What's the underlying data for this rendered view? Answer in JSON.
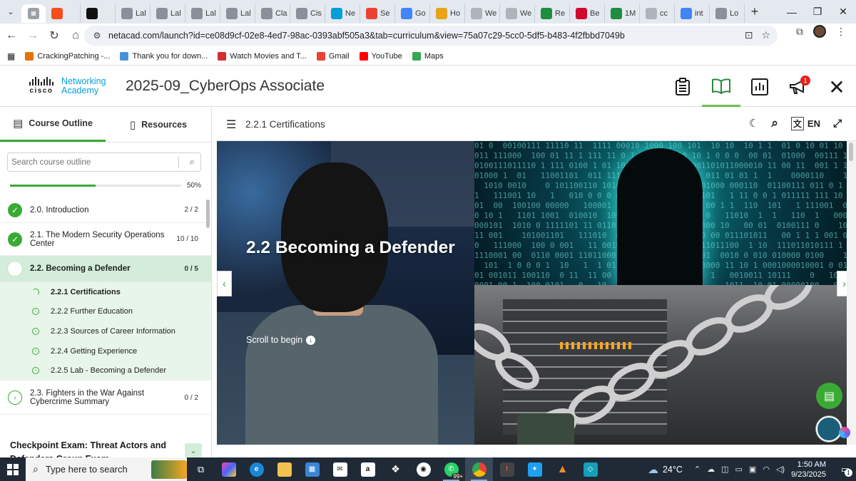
{
  "browser": {
    "tabs": [
      {
        "label": "",
        "icon": "figma-icon",
        "color": "#f24e1e"
      },
      {
        "label": "",
        "icon": "medium-icon",
        "color": "#111111"
      },
      {
        "label": "Lal",
        "icon": "lab-icon",
        "color": "#8a8f99"
      },
      {
        "label": "Lal",
        "icon": "lab-icon",
        "color": "#8a8f99"
      },
      {
        "label": "Lal",
        "icon": "lab-icon",
        "color": "#8a8f99"
      },
      {
        "label": "Lal",
        "icon": "lab-icon",
        "color": "#8a8f99"
      },
      {
        "label": "Cla",
        "icon": "lab-icon",
        "color": "#8a8f99"
      },
      {
        "label": "Cis",
        "icon": "lab-icon",
        "color": "#8a8f99"
      },
      {
        "label": "Ne",
        "icon": "netacad-icon",
        "color": "#049fd9"
      },
      {
        "label": "Se",
        "icon": "gmail-icon",
        "color": "#ea4335"
      },
      {
        "label": "Go",
        "icon": "gemini-icon",
        "color": "#4285f4"
      },
      {
        "label": "Ho",
        "icon": "home-icon",
        "color": "#e8a317"
      },
      {
        "label": "We",
        "icon": "web-icon",
        "color": "#b0b4ba"
      },
      {
        "label": "We",
        "icon": "web-icon",
        "color": "#b0b4ba"
      },
      {
        "label": "Re",
        "icon": "reg-icon",
        "color": "#1e8e3e"
      },
      {
        "label": "Be",
        "icon": "huawei-icon",
        "color": "#cf0a2c"
      },
      {
        "label": "1M",
        "icon": "reg-icon",
        "color": "#1e8e3e"
      },
      {
        "label": "cc",
        "icon": "web-icon",
        "color": "#b0b4ba"
      },
      {
        "label": "int",
        "icon": "google-icon",
        "color": "#4285f4"
      },
      {
        "label": "Lo",
        "icon": "lab-icon",
        "color": "#8a8f99"
      }
    ],
    "url": "netacad.com/launch?id=ce08d9cf-02e8-4ed7-98ac-0393abf505a3&tab=curriculum&view=75a07c29-5cc0-5df5-b483-4f2fbbd7049b",
    "bookmarks": [
      {
        "label": "CrackingPatching -...",
        "icon": "crackingpatching-icon",
        "color": "#e37400"
      },
      {
        "label": "Thank you for down...",
        "icon": "bookmark-fav-icon",
        "color": "#4a90d9"
      },
      {
        "label": "Watch Movies and T...",
        "icon": "movies-icon",
        "color": "#d32f2f"
      },
      {
        "label": "Gmail",
        "icon": "gmail-icon",
        "color": "#ea4335"
      },
      {
        "label": "YouTube",
        "icon": "youtube-icon",
        "color": "#ff0000"
      },
      {
        "label": "Maps",
        "icon": "maps-icon",
        "color": "#34a853"
      }
    ]
  },
  "header": {
    "logo_brand": "cisco",
    "logo_line1": "Networking",
    "logo_line2": "Academy",
    "course_title": "2025-09_CyberOps Associate",
    "notification_count": "1"
  },
  "sidebar": {
    "tab_outline": "Course Outline",
    "tab_resources": "Resources",
    "search_placeholder": "Search course outline",
    "progress_percent": "50%",
    "progress_value": 0.5,
    "modules": [
      {
        "label": "2.0. Introduction",
        "count": "2 / 2",
        "status": "complete"
      },
      {
        "label": "2.1. The Modern Security Operations Center",
        "count": "10 / 10",
        "status": "complete"
      },
      {
        "label": "2.2. Becoming a Defender",
        "count": "0 / 5",
        "status": "in-progress"
      }
    ],
    "subitems": [
      {
        "label": "2.2.1 Certifications",
        "current": true
      },
      {
        "label": "2.2.2 Further Education",
        "current": false
      },
      {
        "label": "2.2.3 Sources of Career Information",
        "current": false
      },
      {
        "label": "2.2.4 Getting Experience",
        "current": false
      },
      {
        "label": "2.2.5 Lab - Becoming a Defender",
        "current": false
      }
    ],
    "next_module": {
      "label": "2.3. Fighters in the War Against Cybercrime Summary",
      "count": "0 / 2"
    },
    "checkpoint": "Checkpoint Exam: Threat Actors and Defenders Group Exam"
  },
  "content": {
    "section_title": "2.2.1 Certifications",
    "language": "EN",
    "hero_title": "2.2 Becoming a Defender",
    "scroll_prompt": "Scroll to begin"
  },
  "taskbar": {
    "search_placeholder": "Type here to search",
    "weather": "24°C",
    "time": "1:50 AM",
    "date": "9/23/2025",
    "whatsapp_badge": "99+",
    "notification_badge": "1"
  },
  "colors": {
    "accent_green": "#3aaa35",
    "cisco_blue": "#049fd9",
    "current_row_bg": "#d4edda"
  }
}
